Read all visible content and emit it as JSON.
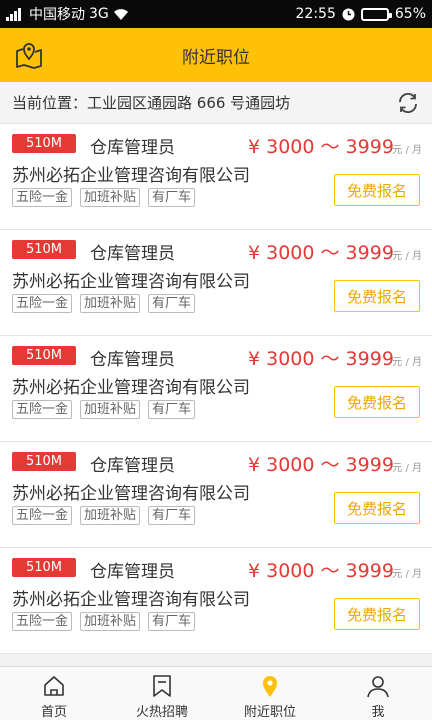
{
  "status_bar": {
    "carrier": "中国移动",
    "network": "3G",
    "time": "22:55",
    "battery": "65%",
    "battery_level": 0.65
  },
  "header": {
    "title": "附近职位",
    "map_icon": "map-location-icon"
  },
  "location": {
    "label": "当前位置：",
    "address": "工业园区通园路 666 号通园坊",
    "refresh_icon": "refresh-icon"
  },
  "jobs": [
    {
      "badge": "510M",
      "title": "仓库管理员",
      "salary": "¥ 3000 ～ 3999",
      "unit": "元 / 月",
      "company": "苏州必拓企业管理咨询有限公司",
      "tags": [
        "五险一金",
        "加班补贴",
        "有厂车"
      ],
      "apply": "免费报名"
    },
    {
      "badge": "510M",
      "title": "仓库管理员",
      "salary": "¥ 3000 ～ 3999",
      "unit": "元 / 月",
      "company": "苏州必拓企业管理咨询有限公司",
      "tags": [
        "五险一金",
        "加班补贴",
        "有厂车"
      ],
      "apply": "免费报名"
    },
    {
      "badge": "510M",
      "title": "仓库管理员",
      "salary": "¥ 3000 ～ 3999",
      "unit": "元 / 月",
      "company": "苏州必拓企业管理咨询有限公司",
      "tags": [
        "五险一金",
        "加班补贴",
        "有厂车"
      ],
      "apply": "免费报名"
    },
    {
      "badge": "510M",
      "title": "仓库管理员",
      "salary": "¥ 3000 ～ 3999",
      "unit": "元 / 月",
      "company": "苏州必拓企业管理咨询有限公司",
      "tags": [
        "五险一金",
        "加班补贴",
        "有厂车"
      ],
      "apply": "免费报名"
    },
    {
      "badge": "510M",
      "title": "仓库管理员",
      "salary": "¥ 3000 ～ 3999",
      "unit": "元 / 月",
      "company": "苏州必拓企业管理咨询有限公司",
      "tags": [
        "五险一金",
        "加班补贴",
        "有厂车"
      ],
      "apply": "免费报名"
    }
  ],
  "tabs": [
    {
      "label": "首页",
      "icon": "home-icon"
    },
    {
      "label": "火热招聘",
      "icon": "bookmark-icon"
    },
    {
      "label": "附近职位",
      "icon": "location-pin-icon",
      "active": true
    },
    {
      "label": "我",
      "icon": "user-icon"
    }
  ],
  "colors": {
    "accent": "#ffc107",
    "salary": "#e53935",
    "badge": "#e53935"
  }
}
